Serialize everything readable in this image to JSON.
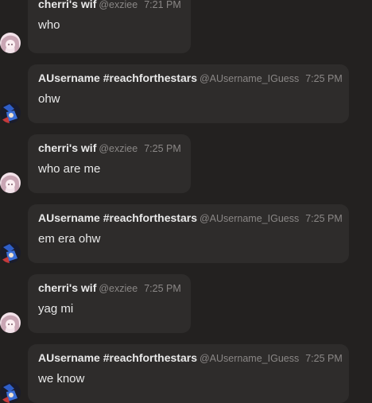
{
  "messages": [
    {
      "author": "cherri's wif",
      "handle": "@exziee",
      "time": "7:21 PM",
      "text": "who",
      "avatar_icon": "pink-anime-avatar-icon"
    },
    {
      "author": "AUsername #reachforthestars",
      "handle": "@AUsername_IGuess",
      "time": "7:25 PM",
      "text": "ohw",
      "avatar_icon": "blue-character-avatar-icon"
    },
    {
      "author": "cherri's wif",
      "handle": "@exziee",
      "time": "7:25 PM",
      "text": "who are me",
      "avatar_icon": "pink-anime-avatar-icon"
    },
    {
      "author": "AUsername #reachforthestars",
      "handle": "@AUsername_IGuess",
      "time": "7:25 PM",
      "text": "em era ohw",
      "avatar_icon": "blue-character-avatar-icon"
    },
    {
      "author": "cherri's wif",
      "handle": "@exziee",
      "time": "7:25 PM",
      "text": "yag mi",
      "avatar_icon": "pink-anime-avatar-icon"
    },
    {
      "author": "AUsername #reachforthestars",
      "handle": "@AUsername_IGuess",
      "time": "7:25 PM",
      "text": "we know",
      "avatar_icon": "blue-character-avatar-icon"
    }
  ],
  "colors": {
    "background": "#232120",
    "bubble": "#2e2c2b",
    "author_text": "#e9e9e9",
    "meta_text": "#8a8786",
    "message_text": "#e8e8e8"
  }
}
